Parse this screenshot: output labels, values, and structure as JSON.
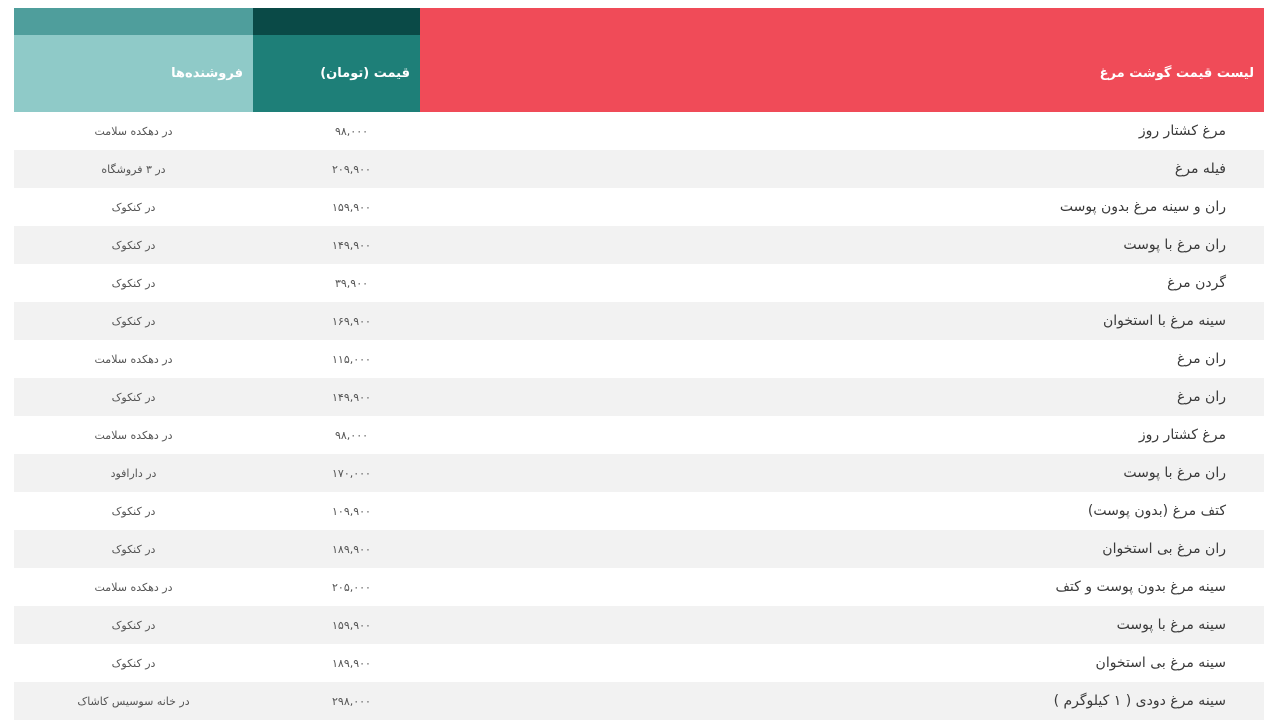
{
  "headers": {
    "product": "لیست قیمت گوشت مرغ",
    "price": "قیمت (تومان)",
    "seller": "فروشنده‌ها"
  },
  "rows": [
    {
      "product": "مرغ کشتار روز",
      "price": "۹۸,۰۰۰",
      "seller": "در دهکده سلامت"
    },
    {
      "product": "فیله مرغ",
      "price": "۲۰۹,۹۰۰",
      "seller": "در ۳ فروشگاه"
    },
    {
      "product": "ران و سینه مرغ بدون پوست",
      "price": "۱۵۹,۹۰۰",
      "seller": "در کنکوک"
    },
    {
      "product": "ران مرغ با پوست",
      "price": "۱۴۹,۹۰۰",
      "seller": "در کنکوک"
    },
    {
      "product": "گردن مرغ",
      "price": "۳۹,۹۰۰",
      "seller": "در کنکوک"
    },
    {
      "product": "سینه مرغ با استخوان",
      "price": "۱۶۹,۹۰۰",
      "seller": "در کنکوک"
    },
    {
      "product": "ران مرغ",
      "price": "۱۱۵,۰۰۰",
      "seller": "در دهکده سلامت"
    },
    {
      "product": "ران مرغ",
      "price": "۱۴۹,۹۰۰",
      "seller": "در کنکوک"
    },
    {
      "product": "مرغ کشتار روز",
      "price": "۹۸,۰۰۰",
      "seller": "در دهکده سلامت"
    },
    {
      "product": "ران مرغ با پوست",
      "price": "۱۷۰,۰۰۰",
      "seller": "در دارافود"
    },
    {
      "product": "کتف مرغ (بدون پوست)",
      "price": "۱۰۹,۹۰۰",
      "seller": "در کنکوک"
    },
    {
      "product": "ران مرغ بی استخوان",
      "price": "۱۸۹,۹۰۰",
      "seller": "در کنکوک"
    },
    {
      "product": "سینه مرغ بدون پوست و کتف",
      "price": "۲۰۵,۰۰۰",
      "seller": "در دهکده سلامت"
    },
    {
      "product": "سینه مرغ با پوست",
      "price": "۱۵۹,۹۰۰",
      "seller": "در کنکوک"
    },
    {
      "product": "سینه مرغ بی استخوان",
      "price": "۱۸۹,۹۰۰",
      "seller": "در کنکوک"
    },
    {
      "product": "سینه مرغ دودی ( ۱ کیلوگرم )",
      "price": "۲۹۸,۰۰۰",
      "seller": "در خانه سوسیس کاشاک"
    }
  ]
}
